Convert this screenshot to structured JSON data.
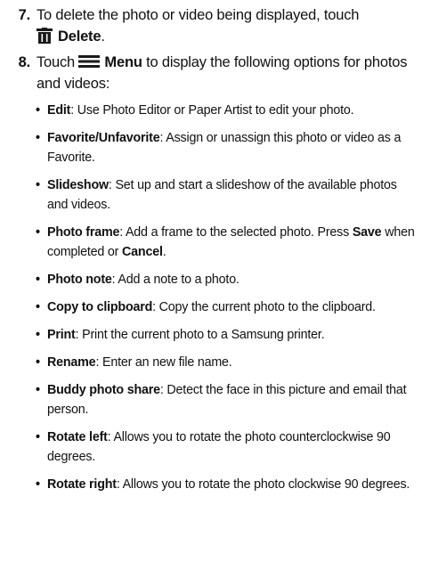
{
  "step7": {
    "number": "7.",
    "text": "To delete the photo or video being displayed, touch",
    "icon": "trash-icon",
    "action": "Delete",
    "end": "."
  },
  "step8": {
    "number": "8.",
    "pre": "Touch",
    "icon": "menu-icon",
    "action": "Menu",
    "post": "to display the following options for photos and videos:"
  },
  "bullets": [
    {
      "term": "Edit",
      "desc": ": Use Photo Editor or Paper Artist to edit your photo."
    },
    {
      "term": "Favorite/Unfavorite",
      "desc": ": Assign or unassign this photo or video as a Favorite."
    },
    {
      "term": "Slideshow",
      "desc": ": Set up and start a slideshow of the available photos and videos."
    },
    {
      "term": "Photo frame",
      "desc": ": Add a frame to the selected photo. Press ",
      "term2": "Save",
      "mid": " when completed or ",
      "term3": "Cancel",
      "end": "."
    },
    {
      "term": "Photo note",
      "desc": ": Add a note to a photo."
    },
    {
      "term": "Copy to clipboard",
      "desc": ": Copy the current photo to the clipboard."
    },
    {
      "term": "Print",
      "desc": ": Print the current photo to a Samsung printer."
    },
    {
      "term": "Rename",
      "desc": ": Enter an new file name."
    },
    {
      "term": "Buddy photo share",
      "desc": ": Detect the face in this picture and email that person."
    },
    {
      "term": "Rotate left",
      "desc": ": Allows you to rotate the photo counterclockwise 90 degrees."
    },
    {
      "term": "Rotate right",
      "desc": ": Allows you to rotate the photo clockwise 90 degrees."
    }
  ],
  "bullet_char": "•",
  "colors": {
    "text": "#111111",
    "icon": "#1a1a1a"
  }
}
